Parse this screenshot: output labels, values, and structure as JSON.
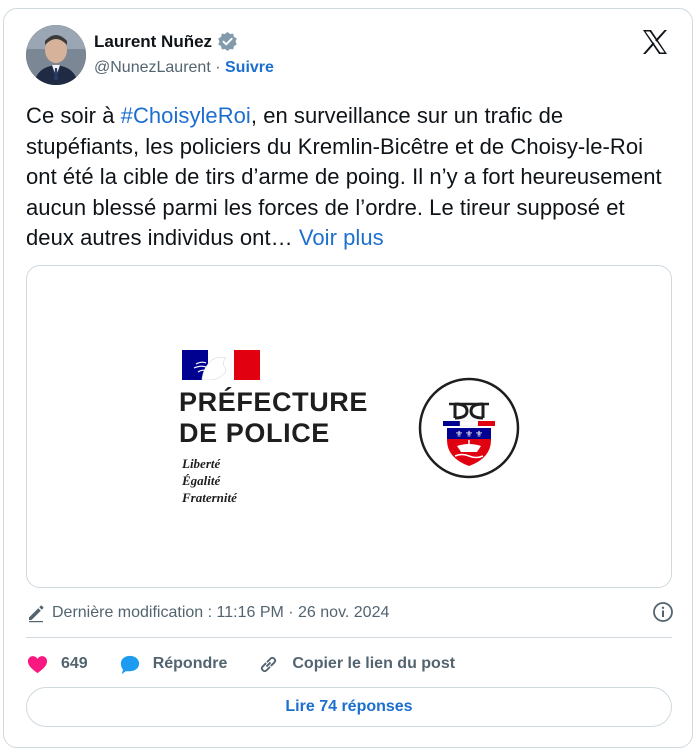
{
  "author": {
    "name": "Laurent Nuñez",
    "handle": "@NunezLaurent",
    "separator": "·",
    "follow_label": "Suivre"
  },
  "tweet": {
    "text_before": "Ce soir à ",
    "hashtag": "#ChoisyleRoi",
    "text_after": ", en surveillance sur un trafic de stupéfiants, les policiers du Kremlin-Bicêtre et de Choisy-le-Roi ont été la cible de tirs d’arme de poing. Il n’y a fort heureusement aucun blessé parmi les forces de l’ordre. Le tireur supposé et deux autres individus ont… ",
    "more_label": "Voir plus"
  },
  "media": {
    "title_line1": "PRÉFECTURE",
    "title_line2": "DE POLICE",
    "motto_line1": "Liberté",
    "motto_line2": "Égalité",
    "motto_line3": "Fraternité",
    "emblem_letters": "PP"
  },
  "meta": {
    "edited_text": "Dernière modification : 11:16 PM · 26 nov. 2024"
  },
  "actions": {
    "like_count": "649",
    "reply_label": "Répondre",
    "copy_label": "Copier le lien du post"
  },
  "read_replies_label": "Lire 74 réponses",
  "colors": {
    "link": "#1d6fcf",
    "heart": "#f91880",
    "reply_icon": "#1d9bf0",
    "muted": "#536471",
    "border": "#cfd9de",
    "flag_blue": "#000091",
    "flag_red": "#e1000f"
  },
  "icons": [
    "verified-badge-icon",
    "x-logo-icon",
    "pencil-icon",
    "info-icon",
    "heart-icon",
    "speech-bubble-icon",
    "link-icon"
  ]
}
